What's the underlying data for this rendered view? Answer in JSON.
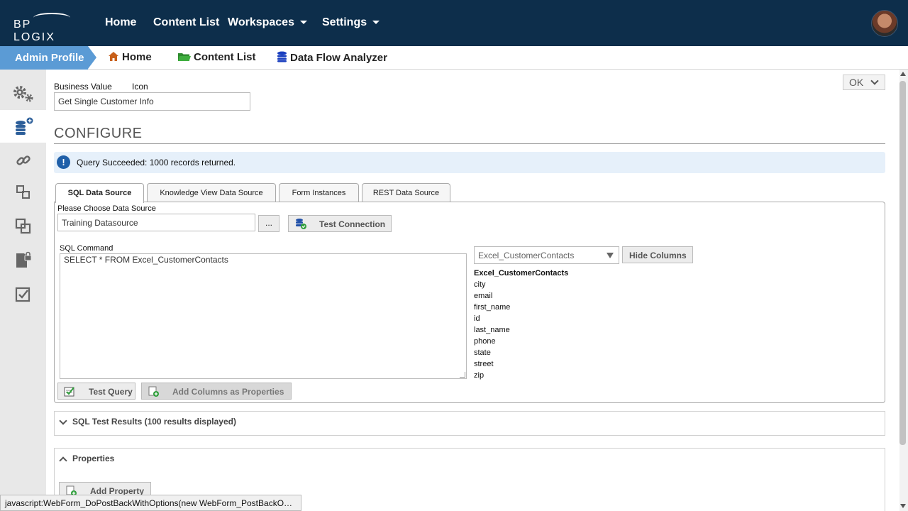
{
  "topnav": {
    "logo": "BP LOGIX",
    "items": [
      {
        "label": "Home"
      },
      {
        "label": "Content List"
      },
      {
        "label": "Workspaces"
      },
      {
        "label": "Settings"
      }
    ]
  },
  "breadcrumb": {
    "current": "Admin Profile",
    "links": [
      {
        "label": "Home",
        "icon": "home-icon"
      },
      {
        "label": "Content List",
        "icon": "folder-icon"
      },
      {
        "label": "Data Flow Analyzer",
        "icon": "database-icon"
      }
    ]
  },
  "sidebar": {
    "items": [
      {
        "icon": "gears-icon",
        "active": false
      },
      {
        "icon": "database-add-icon",
        "active": true
      },
      {
        "icon": "link-icon",
        "active": false
      },
      {
        "icon": "linked-boxes-icon",
        "active": false
      },
      {
        "icon": "overlap-boxes-icon",
        "active": false
      },
      {
        "icon": "locked-document-icon",
        "active": false
      },
      {
        "icon": "checkbox-icon",
        "active": false
      }
    ]
  },
  "form": {
    "business_value_label": "Business Value",
    "icon_label": "Icon",
    "business_value": "Get Single Customer Info",
    "ok_label": "OK",
    "section_title": "CONFIGURE",
    "alert": "Query Succeeded: 1000 records returned."
  },
  "tabs": [
    {
      "label": "SQL Data Source",
      "active": true
    },
    {
      "label": "Knowledge View Data Source",
      "active": false
    },
    {
      "label": "Form Instances",
      "active": false
    },
    {
      "label": "REST Data Source",
      "active": false
    }
  ],
  "sql": {
    "choose_label": "Please Choose Data Source",
    "datasource": "Training Datasource",
    "browse_label": "...",
    "test_connection": "Test Connection",
    "command_label": "SQL Command",
    "command": "SELECT * FROM Excel_CustomerContacts",
    "table_select": "Excel_CustomerContacts",
    "hide_columns": "Hide Columns",
    "table_name": "Excel_CustomerContacts",
    "columns": [
      "city",
      "email",
      "first_name",
      "id",
      "last_name",
      "phone",
      "state",
      "street",
      "zip"
    ],
    "test_query": "Test Query",
    "add_columns": "Add Columns as Properties"
  },
  "panels": {
    "results": "SQL Test Results (100 results displayed)",
    "properties": "Properties",
    "add_property": "Add Property"
  },
  "status_bar": "javascript:WebForm_DoPostBackWithOptions(new WebForm_PostBackOptio..."
}
